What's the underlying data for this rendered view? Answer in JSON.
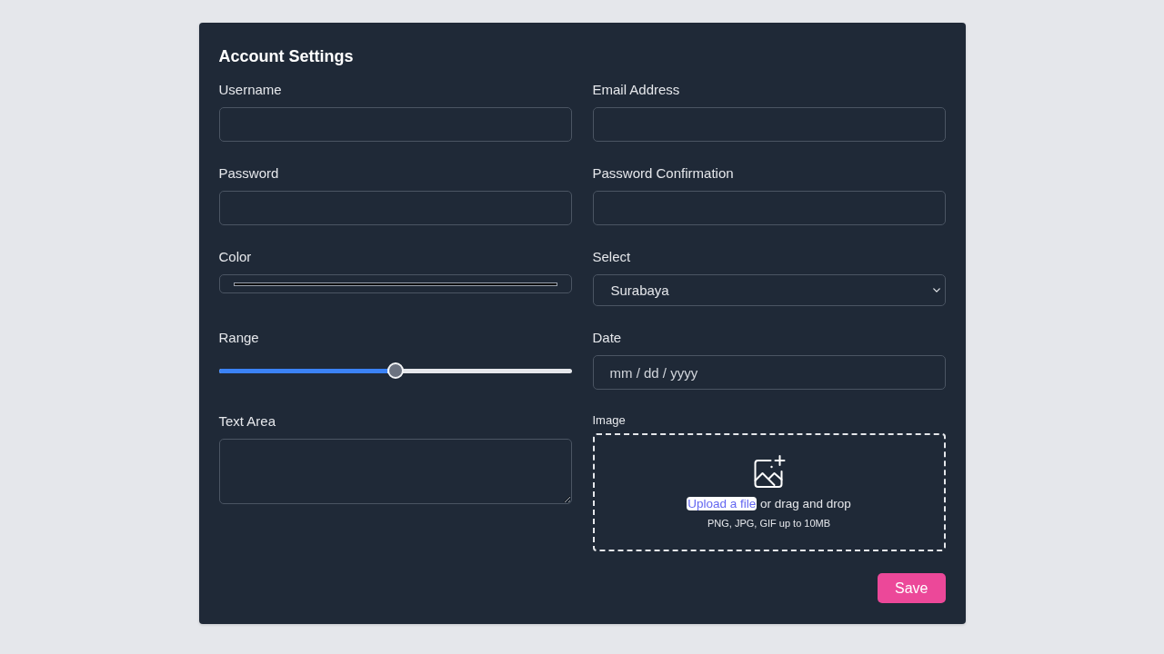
{
  "form": {
    "title": "Account Settings",
    "fields": [
      {
        "kind": "text",
        "label": "Username"
      },
      {
        "kind": "email",
        "label": "Email Address"
      },
      {
        "kind": "password",
        "label": "Password"
      },
      {
        "kind": "password",
        "label": "Password Confirmation"
      },
      {
        "kind": "color",
        "label": "Color"
      },
      {
        "kind": "select",
        "label": "Select",
        "value": "Surabaya"
      },
      {
        "kind": "range",
        "label": "Range",
        "level": 0.5
      },
      {
        "kind": "date",
        "label": "Date",
        "placeholder": "mm / dd / yyyy"
      },
      {
        "kind": "textarea",
        "label": "Text Area"
      },
      {
        "kind": "file",
        "label": "Image",
        "link": "Upload a file",
        "text": "or drag and drop",
        "hint": "PNG, JPG, GIF up to 10MB"
      }
    ],
    "save_button": "Save"
  }
}
